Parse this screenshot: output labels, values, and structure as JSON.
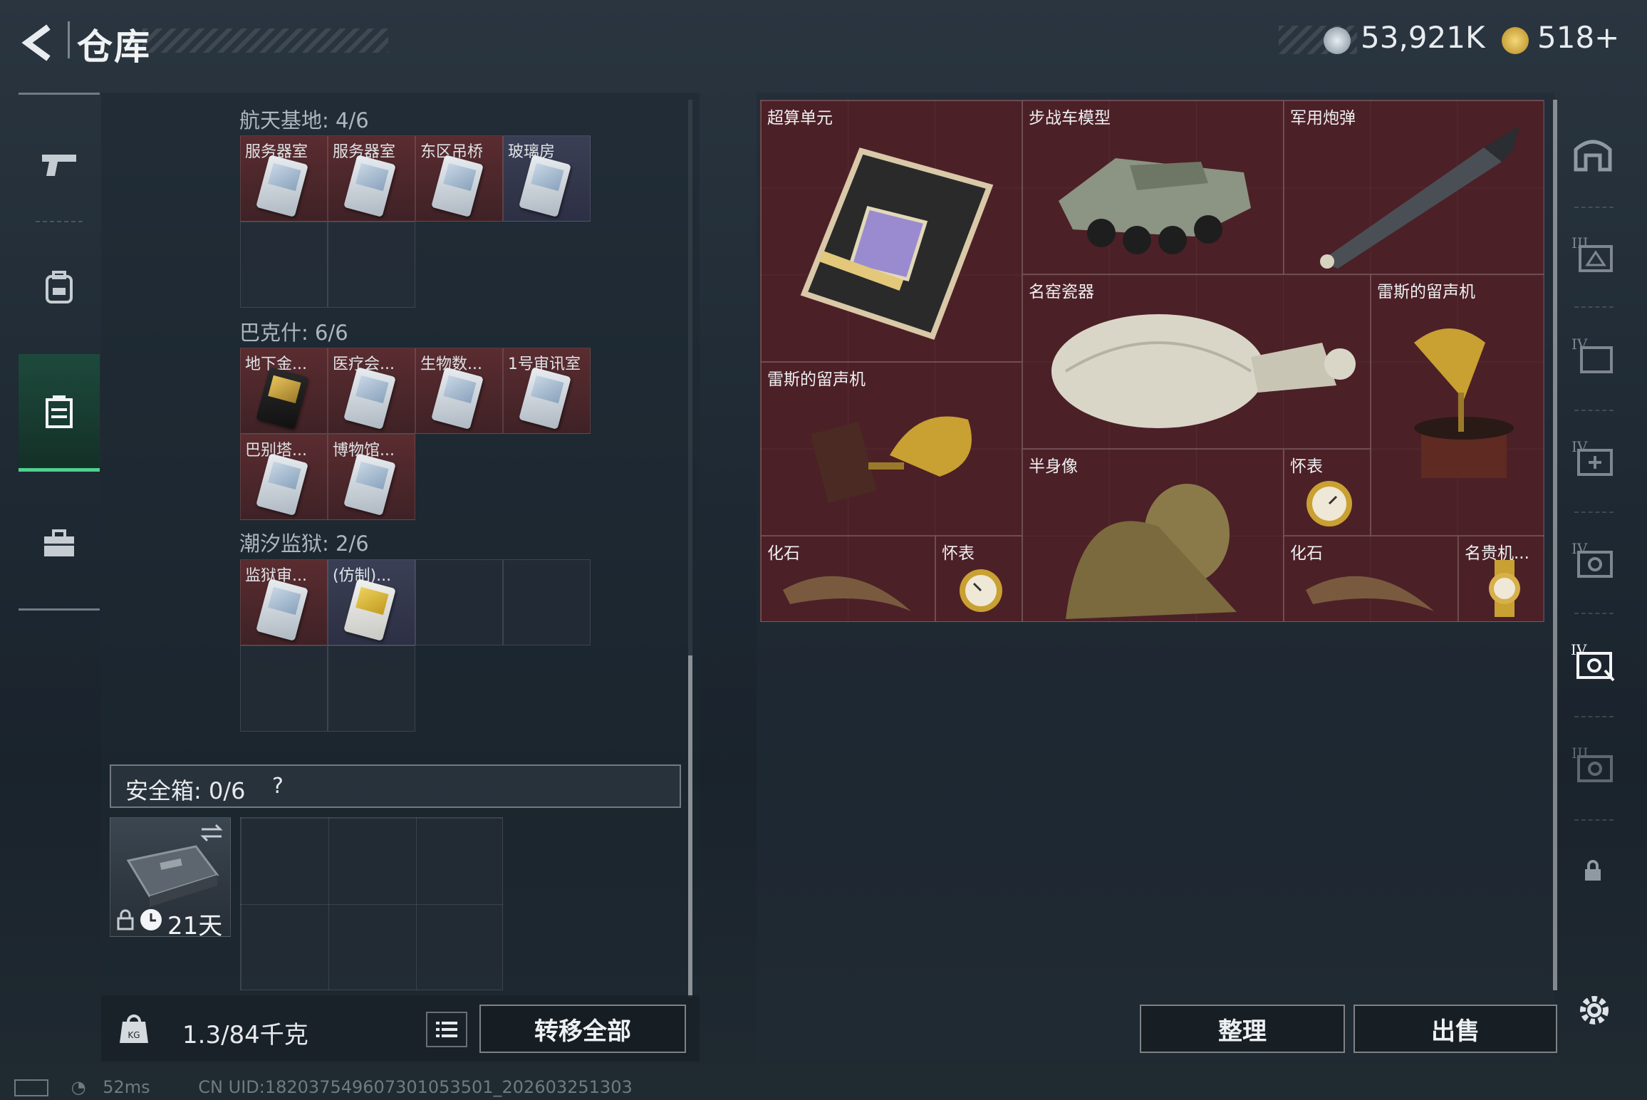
{
  "header": {
    "title": "仓库",
    "currency1_value": "53,921K",
    "currency2_value": "518+"
  },
  "left_nav": {
    "items": [
      "weapon-tab-icon",
      "backpack-tab-icon",
      "storage-tab-icon",
      "briefcase-tab-icon"
    ],
    "active": "storage-tab-icon"
  },
  "keycards": {
    "sections": [
      {
        "label": "航天基地: 4/6",
        "cells": [
          "服务器室",
          "服务器室",
          "东区吊桥",
          "玻璃房"
        ]
      },
      {
        "label": "巴克什: 6/6",
        "cells": [
          "地下金...",
          "医疗会...",
          "生物数...",
          "1号审讯室",
          "巴别塔...",
          "博物馆..."
        ]
      },
      {
        "label": "潮汐监狱: 2/6",
        "cells": [
          "监狱审...",
          "(仿制)..."
        ]
      }
    ]
  },
  "safe_box": {
    "label": "安全箱:",
    "count": "0/6",
    "help": "?",
    "timer": "21天"
  },
  "bottom_left": {
    "weight": "1.3/84千克",
    "transfer_all": "转移全部"
  },
  "storage_items": [
    "超算单元",
    "步战车模型",
    "军用炮弹",
    "名窑瓷器",
    "雷斯的留声机",
    "雷斯的留声机",
    "半身像",
    "怀表",
    "化石",
    "怀表",
    "化石",
    "名贵机..."
  ],
  "bottom_right": {
    "organize": "整理",
    "sell": "出售"
  },
  "status_bar": {
    "ping": "52ms",
    "uid": "CN UID:182037549607301053501_202603251303"
  },
  "colors": {
    "accent_green": "#4fd08f",
    "item_bg": "#4a2329"
  }
}
